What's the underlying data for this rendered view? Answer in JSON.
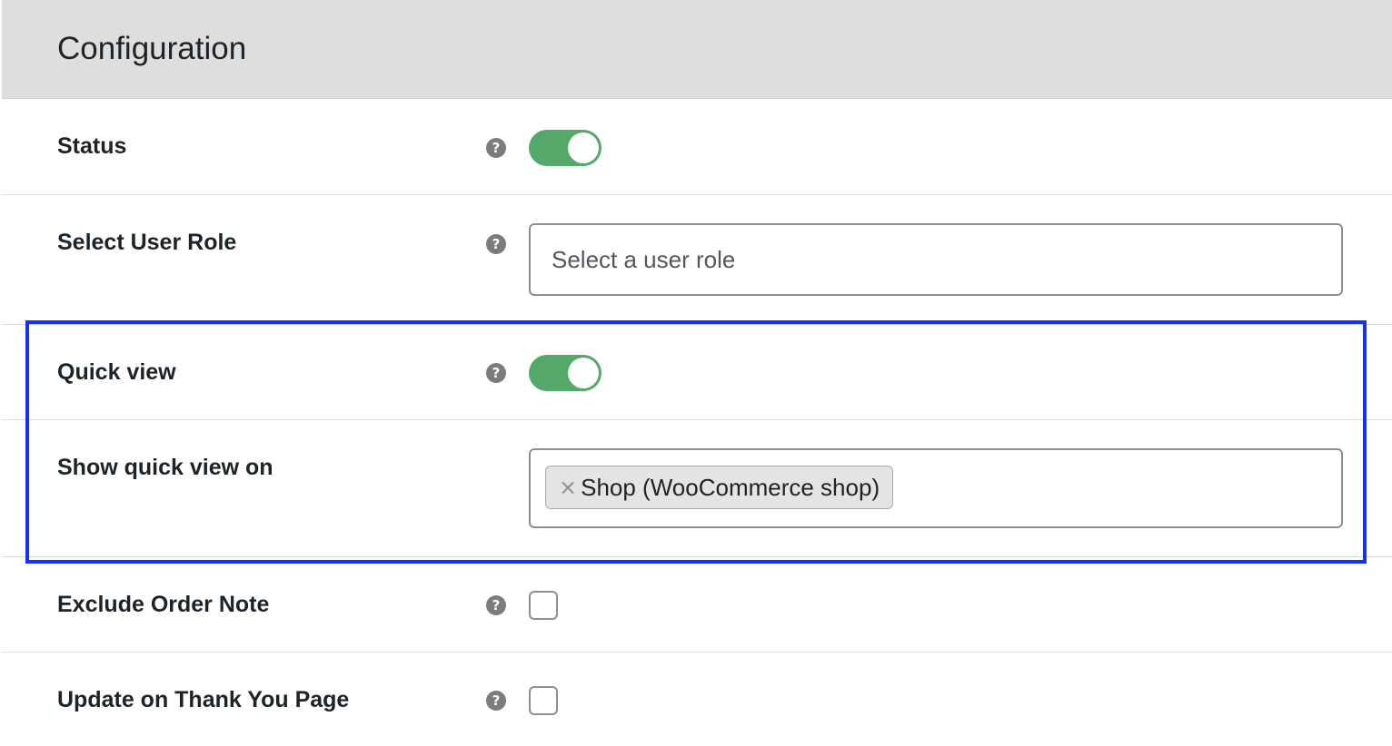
{
  "header": {
    "title": "Configuration"
  },
  "rows": {
    "status": {
      "label": "Status",
      "help_icon": "question-mark-icon",
      "help_glyph": "?",
      "enabled": true
    },
    "user_role": {
      "label": "Select User Role",
      "help_icon": "question-mark-icon",
      "help_glyph": "?",
      "placeholder": "Select a user role",
      "value": ""
    },
    "quick_view": {
      "label": "Quick view",
      "help_icon": "question-mark-icon",
      "help_glyph": "?",
      "enabled": true
    },
    "show_quick_view_on": {
      "label": "Show quick view on",
      "selected_tags": [
        {
          "remove_glyph": "×",
          "label": "Shop (WooCommerce shop)"
        }
      ]
    },
    "exclude_order_note": {
      "label": "Exclude Order Note",
      "help_icon": "question-mark-icon",
      "help_glyph": "?",
      "checked": false
    },
    "update_on_thank_you": {
      "label": "Update on Thank You Page",
      "help_icon": "question-mark-icon",
      "help_glyph": "?",
      "checked": false
    }
  },
  "colors": {
    "header_bg": "#dedede",
    "toggle_on": "#53a86a",
    "highlight": "#1430ff",
    "help_icon": "#7c7c7c"
  }
}
